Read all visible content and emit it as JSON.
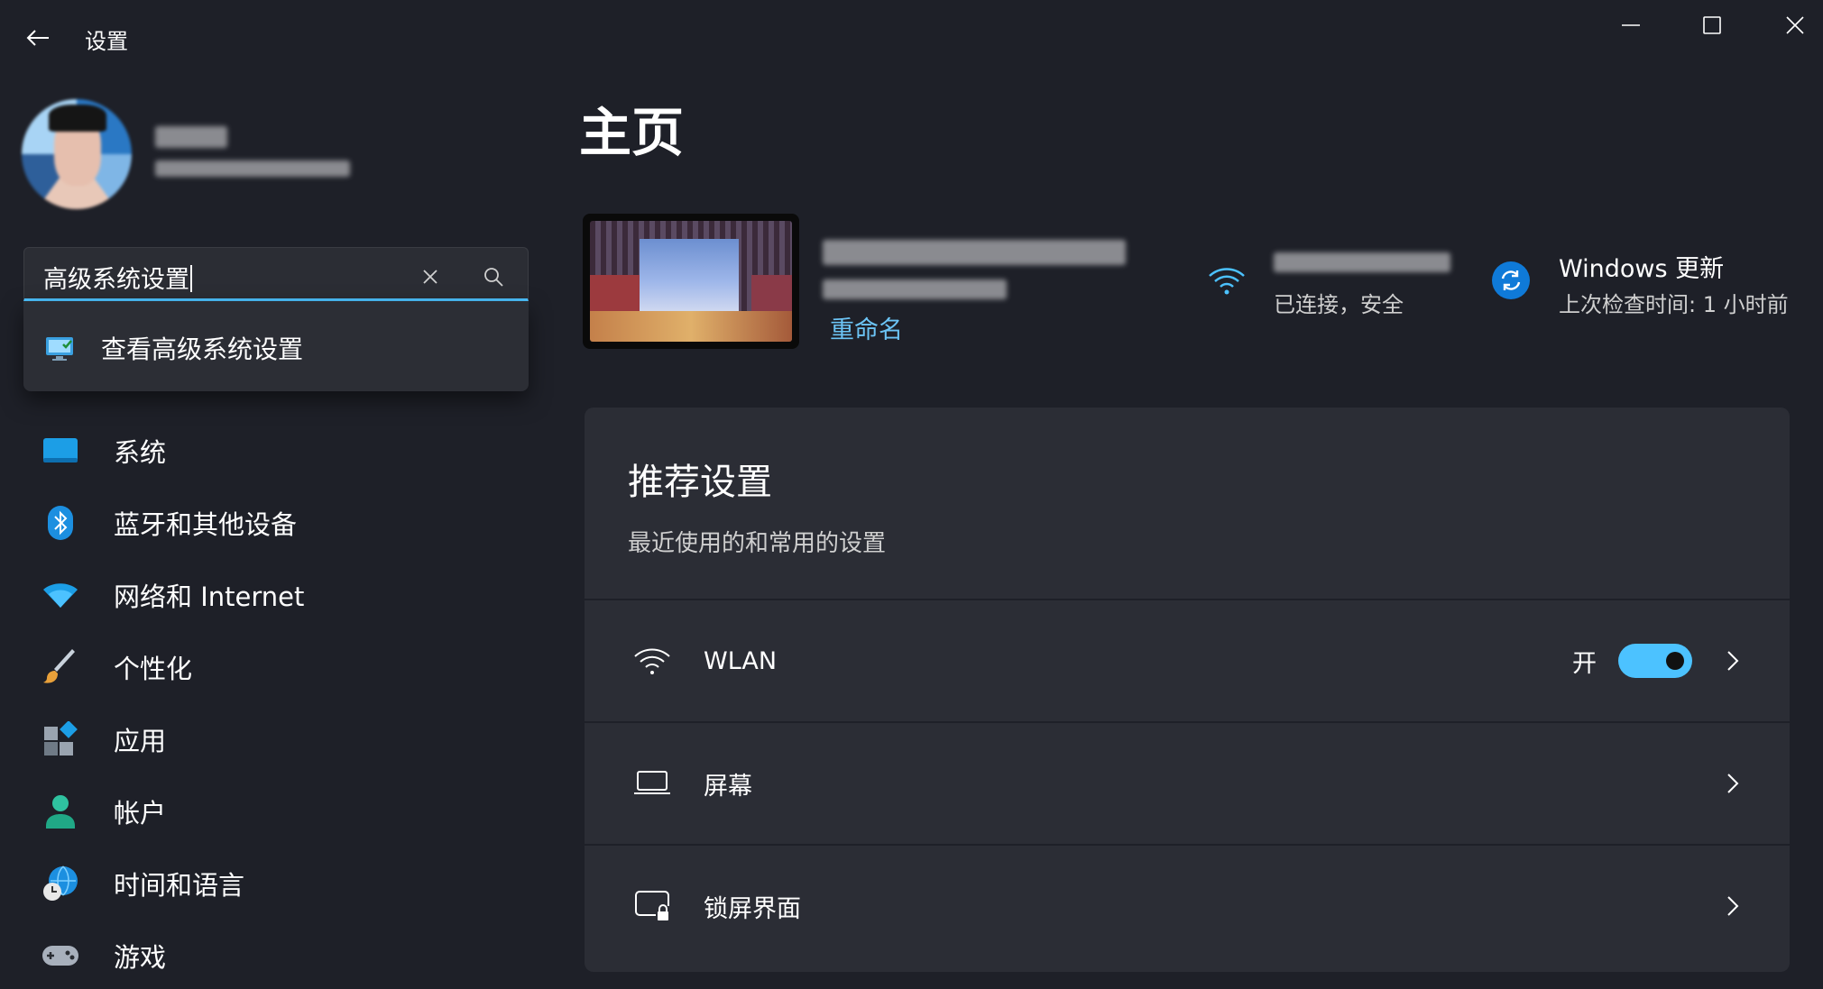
{
  "window": {
    "title": "设置",
    "controls": [
      "minimize-icon",
      "maximize-icon",
      "close-icon"
    ]
  },
  "search": {
    "value": "高级系统设置",
    "suggestions": [
      {
        "label": "查看高级系统设置",
        "icon": "system-properties-icon"
      }
    ]
  },
  "sidebar": {
    "items": [
      {
        "label": "系统",
        "icon": "system-icon"
      },
      {
        "label": "蓝牙和其他设备",
        "icon": "bluetooth-icon"
      },
      {
        "label": "网络和 Internet",
        "icon": "wifi-icon"
      },
      {
        "label": "个性化",
        "icon": "brush-icon"
      },
      {
        "label": "应用",
        "icon": "apps-icon"
      },
      {
        "label": "帐户",
        "icon": "account-icon"
      },
      {
        "label": "时间和语言",
        "icon": "globe-clock-icon"
      },
      {
        "label": "游戏",
        "icon": "gamepad-icon"
      }
    ]
  },
  "main": {
    "title": "主页",
    "device": {
      "rename_label": "重命名"
    },
    "network": {
      "status": "已连接，安全"
    },
    "update": {
      "title": "Windows 更新",
      "subtitle": "上次检查时间: 1 小时前"
    },
    "recommended": {
      "title": "推荐设置",
      "subtitle": "最近使用的和常用的设置",
      "rows": [
        {
          "label": "WLAN",
          "state": "开",
          "toggle_on": true,
          "icon": "wifi-icon"
        },
        {
          "label": "屏幕",
          "icon": "laptop-icon"
        },
        {
          "label": "锁屏界面",
          "icon": "lock-screen-icon"
        }
      ]
    }
  },
  "colors": {
    "accent": "#4cc2ff",
    "link": "#6cc4f5",
    "background": "#1e2028",
    "card": "#2b2d35"
  }
}
